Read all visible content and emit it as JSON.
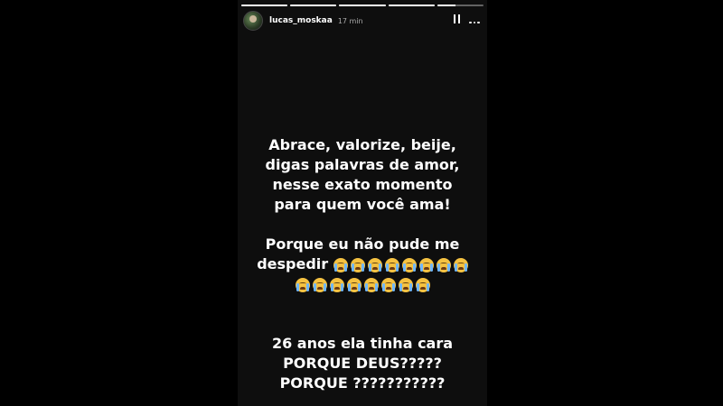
{
  "story": {
    "progress_segments": [
      1,
      1,
      1,
      1,
      0.4
    ],
    "user": {
      "username": "lucas_moskaa",
      "time_ago": "17 min"
    },
    "controls": {
      "pause_icon": "pause-icon",
      "more_icon": "more-options-icon"
    },
    "text": {
      "para1": [
        "Abrace, valorize, beije,",
        "digas palavras de amor,",
        "nesse exato momento",
        "para quem você ama!"
      ],
      "para2_line1": "Porque eu não pude me",
      "para2_line2": "despedir",
      "emoji_name": "loudly-crying-face",
      "emoji_row1_count": 8,
      "emoji_row2_count": 8,
      "para3": [
        "26 anos ela tinha cara",
        "PORQUE DEUS?????",
        "PORQUE ???????????"
      ]
    }
  }
}
